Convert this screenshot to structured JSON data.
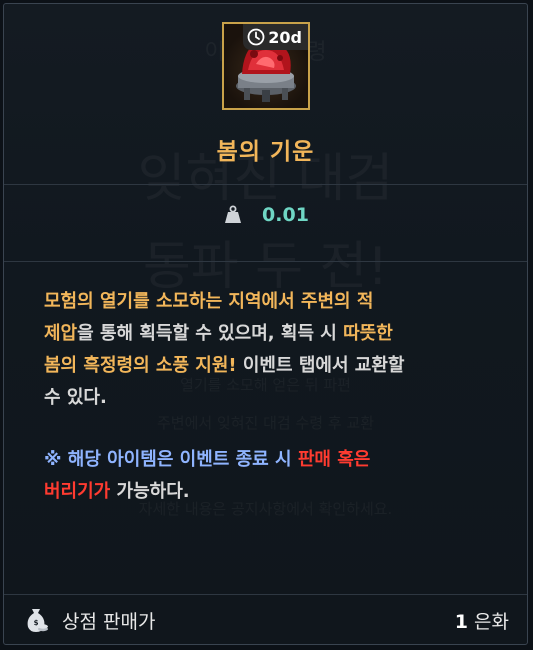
{
  "item": {
    "name": "봄의 기운",
    "icon": "red-blossom-brazier-icon",
    "timer": "20d"
  },
  "weight": {
    "icon": "weight-icon",
    "value": "0.01"
  },
  "description": {
    "lines": [
      [
        {
          "text": "모험의 열기를 소모하는 지역에서 주변의 적",
          "style": "hl"
        }
      ],
      [
        {
          "text": "제압",
          "style": "hl"
        },
        {
          "text": "을 통해 획득할 수 있으며, 획득 시 ",
          "style": "plain"
        },
        {
          "text": "따뜻한",
          "style": "hl"
        }
      ],
      [
        {
          "text": "봄의 흑정령의 소풍 지원!",
          "style": "hl"
        },
        {
          "text": " 이벤트 탭에서 교환할",
          "style": "plain"
        }
      ],
      [
        {
          "text": "수 있다.",
          "style": "plain"
        }
      ]
    ]
  },
  "notice": {
    "lines": [
      [
        {
          "text": "※ 해당 아이템은 이벤트 종료 시 ",
          "style": "blue"
        },
        {
          "text": "판매 혹은",
          "style": "red"
        }
      ],
      [
        {
          "text": "버리기가",
          "style": "red"
        },
        {
          "text": " 가능하다.",
          "style": "plain"
        }
      ]
    ]
  },
  "footer": {
    "icon": "money-bag-icon",
    "label": "상점 판매가",
    "price_value": "1",
    "price_unit": "은화"
  },
  "colors": {
    "name": "#f2b65a",
    "weight": "#6fd6c4",
    "highlight": "#f2b65a",
    "notice_blue": "#8fb4ff",
    "notice_red": "#ff3b30"
  }
}
